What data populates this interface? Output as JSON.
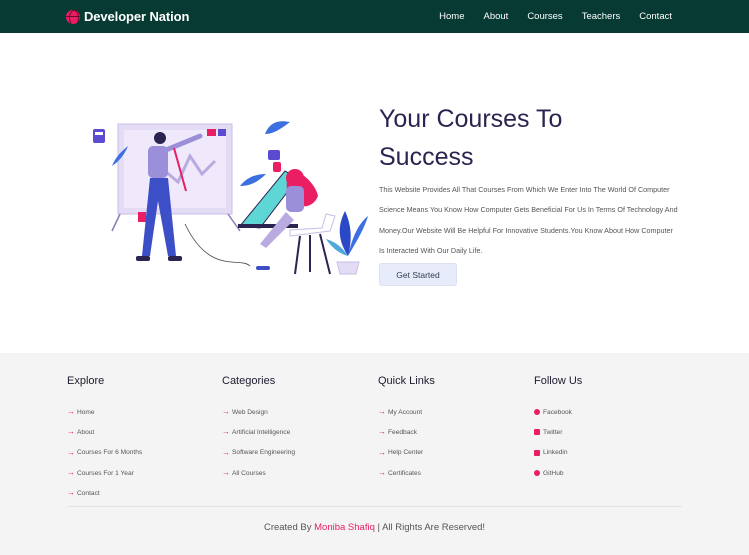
{
  "nav": {
    "brand": "Developer Nation",
    "links": [
      "Home",
      "About",
      "Courses",
      "Teachers",
      "Contact"
    ]
  },
  "hero": {
    "title_line1": "Your Courses To",
    "title_line2": "Success",
    "description": "This Website Provides All That Courses From Which We Enter Into The World Of Computer Science Means You Know How Computer Gets Beneficial For Us In Terms Of Technology And Money.Our Website Will Be Helpful For Innovative Students.You Know About How Computer Is Interacted With Our Daily Life.",
    "cta_label": "Get Started"
  },
  "footer": {
    "explore": {
      "heading": "Explore",
      "items": [
        "Home",
        "About",
        "Courses For 6 Months",
        "Courses For 1 Year",
        "Contact"
      ]
    },
    "categories": {
      "heading": "Categories",
      "items": [
        "Web Design",
        "Artificial Intelligence",
        "Software Engineering",
        "All Courses"
      ]
    },
    "quick_links": {
      "heading": "Quick Links",
      "items": [
        "My Account",
        "Feedback",
        "Help Center",
        "Certificates"
      ]
    },
    "follow_us": {
      "heading": "Follow Us",
      "items": [
        {
          "label": "Facebook",
          "icon": "facebook-icon"
        },
        {
          "label": "Twitter",
          "icon": "twitter-icon"
        },
        {
          "label": "Linkedin",
          "icon": "linkedin-icon"
        },
        {
          "label": "GitHub",
          "icon": "github-icon"
        }
      ]
    },
    "credit_prefix": "Created By",
    "credit_author": "Moniba Shafiq",
    "credit_suffix": "| All Rights Are Reserved!"
  },
  "colors": {
    "nav_bg": "#063a33",
    "accent": "#e91e63",
    "title": "#2a2550",
    "footer_bg": "#f4f4f4"
  }
}
